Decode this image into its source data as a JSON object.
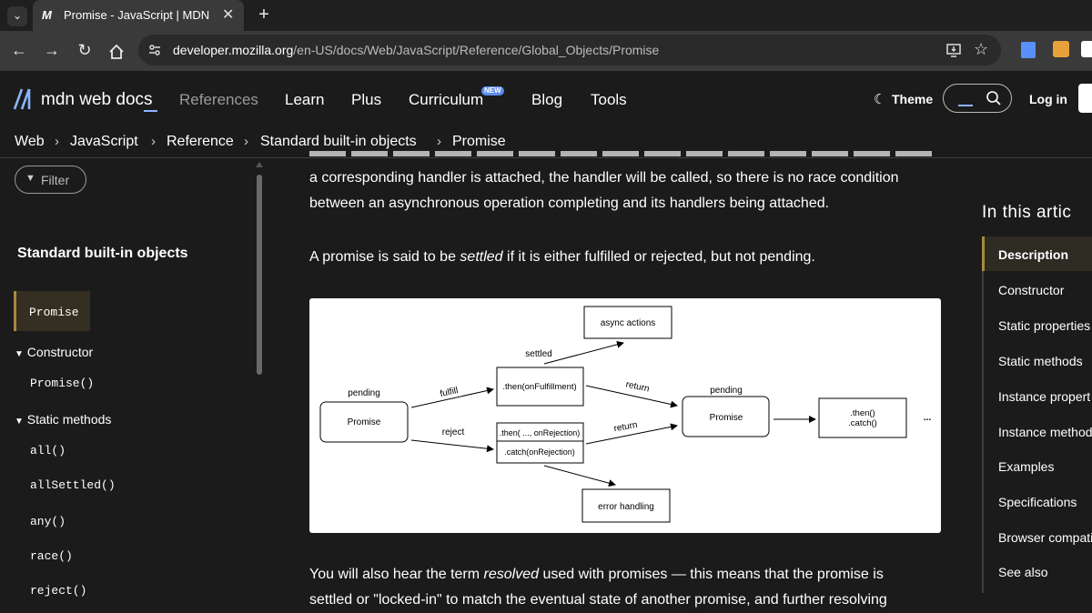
{
  "browser": {
    "tab_title": "Promise - JavaScript | MDN",
    "tab_favicon": "M",
    "url_host": "developer.mozilla.org",
    "url_path": "/en-US/docs/Web/JavaScript/Reference/Global_Objects/Promise"
  },
  "header": {
    "logo_text": "mdn web docs",
    "nav": [
      "References",
      "Learn",
      "Plus",
      "Curriculum",
      "Blog",
      "Tools"
    ],
    "new_badge": "NEW",
    "theme_label": "Theme",
    "login_label": "Log in"
  },
  "breadcrumb": [
    "Web",
    "JavaScript",
    "Reference",
    "Standard built-in objects",
    "Promise"
  ],
  "sidebar": {
    "filter_placeholder": "Filter",
    "section_title": "Standard built-in objects",
    "active_item": "Promise",
    "constructor_heading": "Constructor",
    "constructor_item": "Promise()",
    "static_heading": "Static methods",
    "static_items": [
      "all()",
      "allSettled()",
      "any()",
      "race()",
      "reject()"
    ]
  },
  "main": {
    "para1_line2": "a corresponding handler is attached, the handler will be called, so there is no race condition",
    "para1_line3": "between an asynchronous operation completing and its handlers being attached.",
    "para2_pre": "A promise is said to be ",
    "para2_em": "settled",
    "para2_post": " if it is either fulfilled or rejected, but not pending.",
    "para3_pre": "You will also hear the term ",
    "para3_em": "resolved",
    "para3_post": " used with promises — this means that the promise is",
    "para3_line2": "settled or \"locked-in\" to match the eventual state of another promise, and further resolving"
  },
  "diagram": {
    "async_actions": "async actions",
    "settled": "settled",
    "pending_left": "pending",
    "promise_left": "Promise",
    "fulfill": "fulfill",
    "reject": "reject",
    "then_fulfill": ".then(onFulfillment)",
    "then_reject": ".then( ..., onRejection)",
    "catch_reject": ".catch(onRejection)",
    "return_top": "return",
    "return_bottom": "return",
    "pending_right": "pending",
    "promise_right": "Promise",
    "then_chain": ".then()",
    "catch_chain": ".catch()",
    "ellipsis": "...",
    "error_handling": "error handling"
  },
  "toc": {
    "heading": "In this artic",
    "items": [
      "Description",
      "Constructor",
      "Static properties",
      "Static methods",
      "Instance propert",
      "Instance method",
      "Examples",
      "Specifications",
      "Browser compati",
      "See also"
    ]
  },
  "colors": {
    "accent_blue": "#8cb4ff",
    "active_border": "#a9893b",
    "active_bg": "#342f22",
    "toc_active_bg": "#2d2b22"
  }
}
